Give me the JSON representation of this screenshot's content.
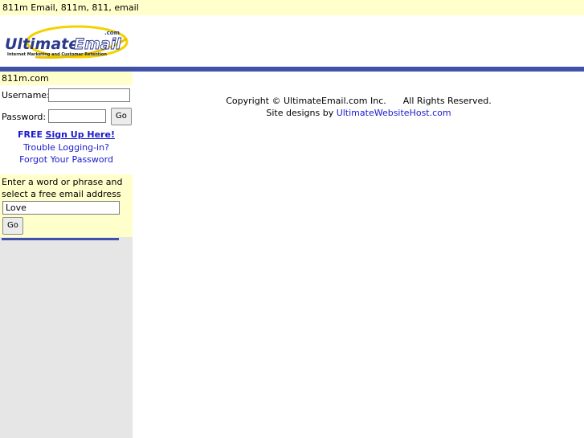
{
  "header": {
    "keywords": "811m Email, 811m, 811, email"
  },
  "logo": {
    "brand_first": "Ultimate",
    "brand_second": "Email",
    "dotcom": ".com",
    "tagline": "Internet Marketing and Customer Retention"
  },
  "sidebar": {
    "site_name": "811m.com",
    "login": {
      "username_label": "Username:",
      "username_value": "",
      "password_label": "Password:",
      "password_value": "",
      "go_label": "Go",
      "free_label": "FREE",
      "signup_link": "Sign Up Here!",
      "trouble_link": "Trouble Logging-in?",
      "forgot_link": "Forgot Your Password"
    },
    "search": {
      "prompt": "Enter a word or phrase and select a free email address",
      "value": "Love",
      "go_label": "Go"
    }
  },
  "footer": {
    "copyright": "Copyright © UltimateEmail.com Inc.      All Rights Reserved.",
    "designs_prefix": "Site designs by",
    "designs_link": "UltimateWebsiteHost.com"
  },
  "colors": {
    "accent_blue": "#3f51a8",
    "highlight_yellow": "#ffffcc",
    "link_blue": "#1a1acc",
    "sidebar_gray": "#e6e6e6"
  }
}
